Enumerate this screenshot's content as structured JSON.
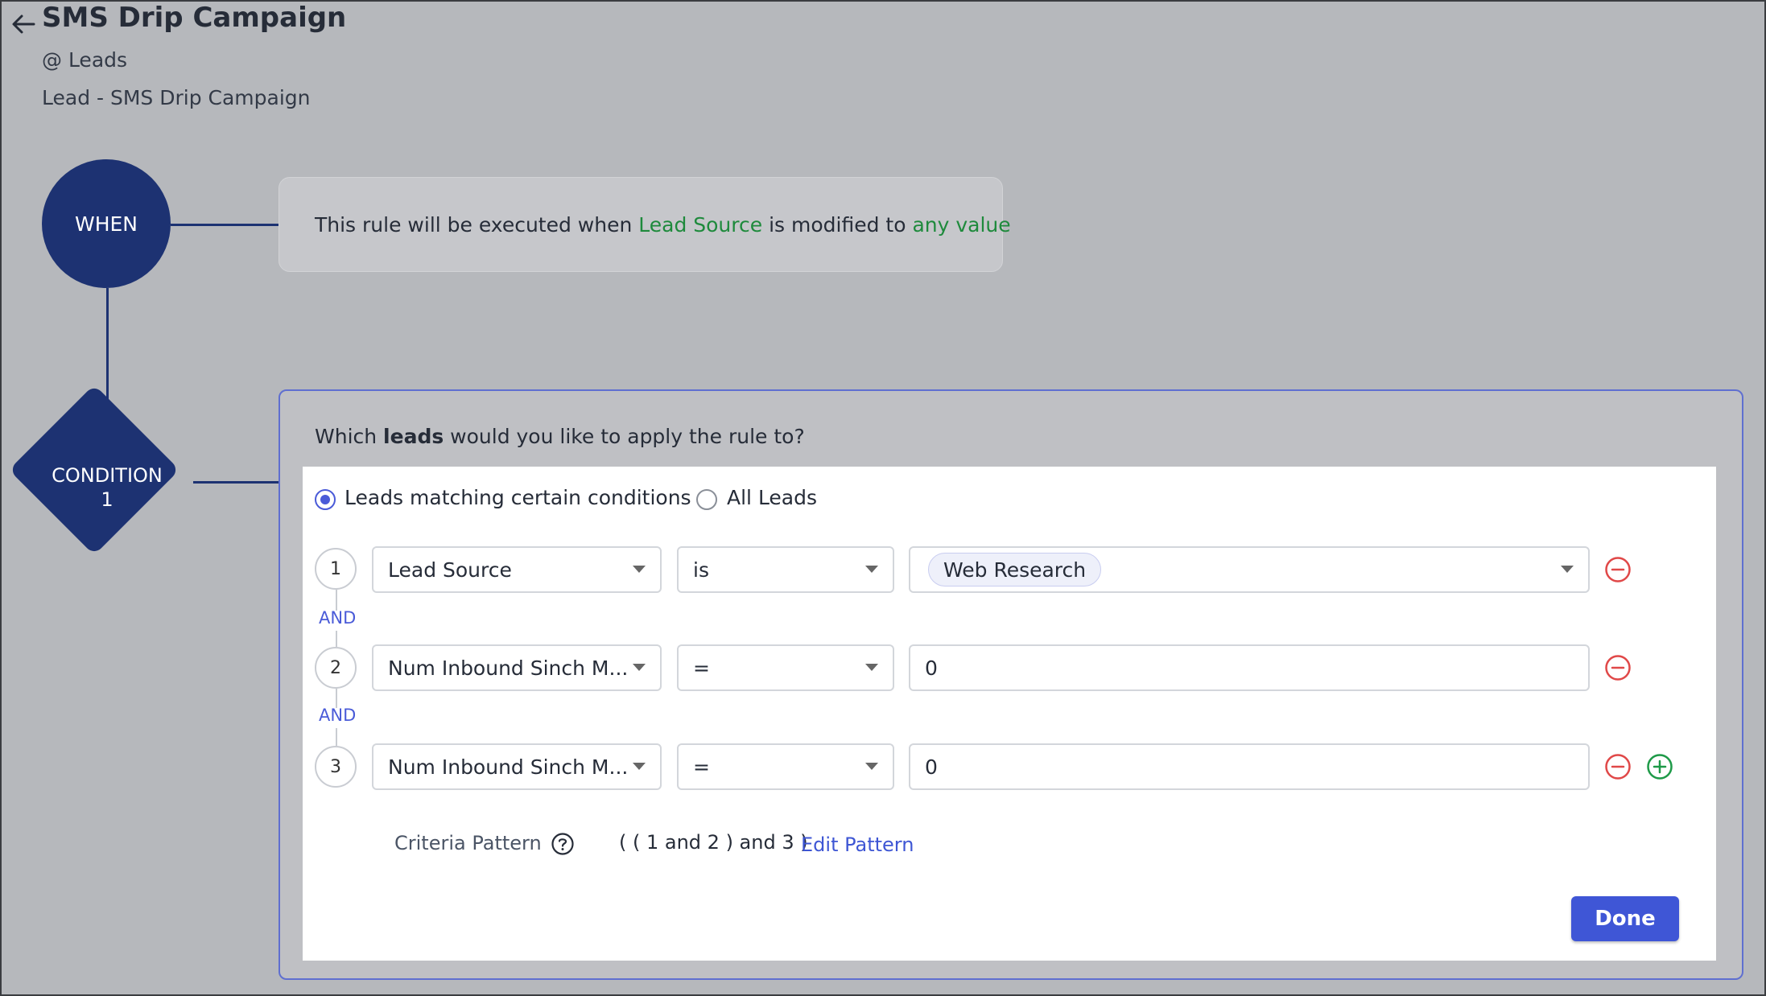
{
  "header": {
    "title": "SMS Drip Campaign",
    "module": "@ Leads",
    "rule_name": "Lead - SMS Drip Campaign"
  },
  "flow": {
    "when_label": "WHEN",
    "condition_label_line1": "CONDITION",
    "condition_label_line2": "1",
    "node_color": "#1d3272"
  },
  "when_card": {
    "text_before": "This rule will be executed when ",
    "field": "Lead Source",
    "text_middle": " is modified to ",
    "value": "any value",
    "highlight_color": "#1e8a3c"
  },
  "condition": {
    "question_before": "Which ",
    "question_bold": "leads",
    "question_after": " would you like to apply the rule to?",
    "options": [
      {
        "label": "Leads matching certain conditions",
        "selected": true
      },
      {
        "label": "All Leads",
        "selected": false
      }
    ],
    "connector": "AND",
    "rows": [
      {
        "number": "1",
        "field": "Lead Source",
        "operator": "is",
        "value": "Web Research",
        "value_type": "chip"
      },
      {
        "number": "2",
        "field": "Num Inbound Sinch M...",
        "operator": "=",
        "value": "0",
        "value_type": "text"
      },
      {
        "number": "3",
        "field": "Num Inbound Sinch M...",
        "operator": "=",
        "value": "0",
        "value_type": "text"
      }
    ],
    "criteria_label": "Criteria Pattern",
    "criteria_pattern": "( ( 1 and 2 ) and 3 )",
    "edit_pattern_label": "Edit Pattern",
    "done_label": "Done",
    "accent_color": "#3f56d6"
  }
}
